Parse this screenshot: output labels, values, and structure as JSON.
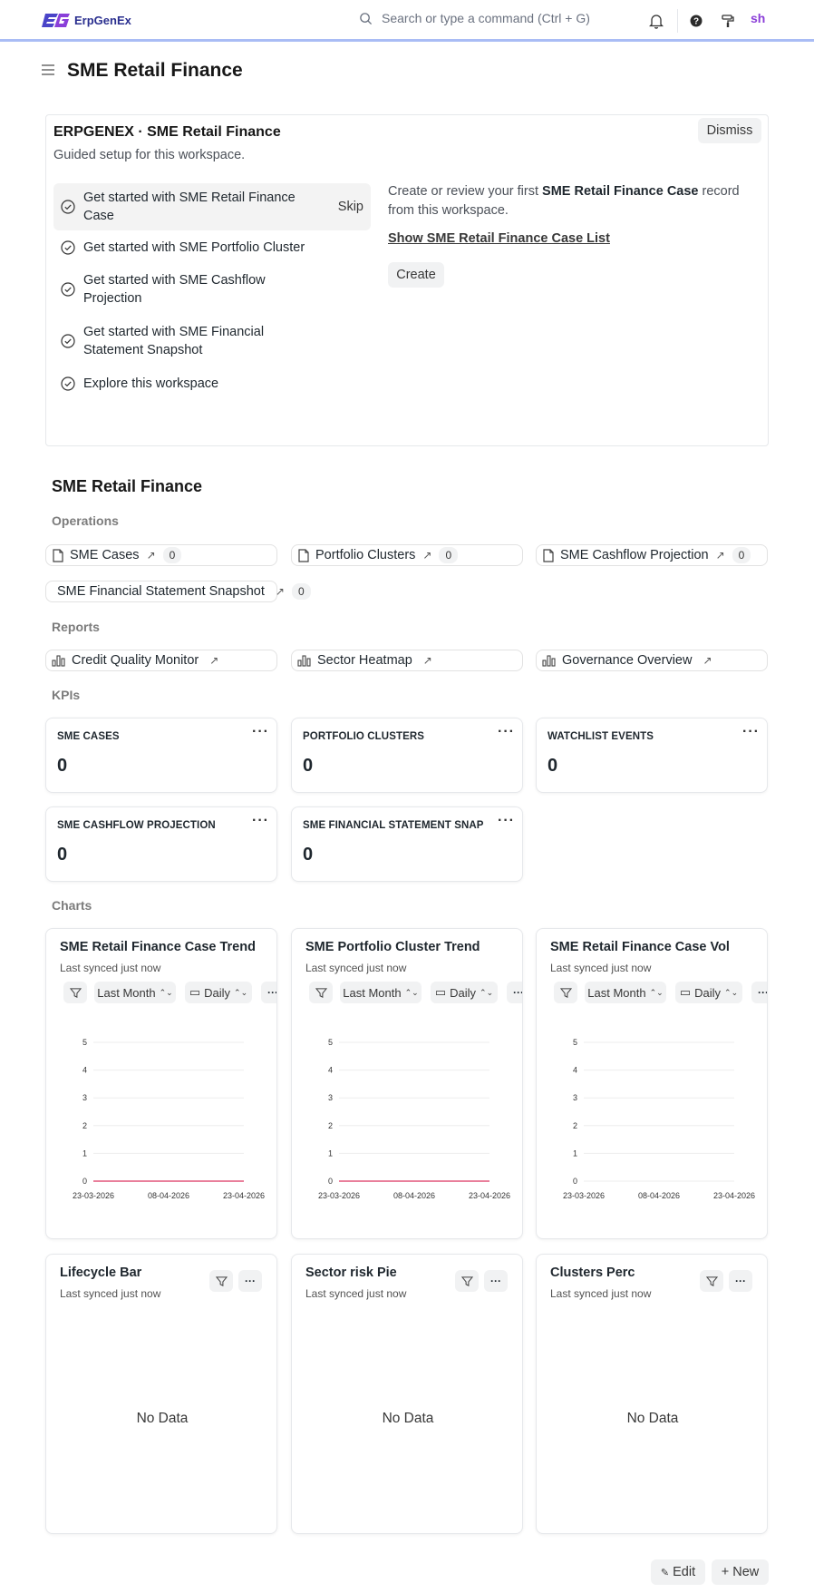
{
  "navbar": {
    "brand": "ErpGenEx",
    "search_placeholder": "Search or type a command (Ctrl + G)",
    "avatar_initials": "sh"
  },
  "page": {
    "title": "SME Retail Finance"
  },
  "onboarding": {
    "title": "ERPGENEX · SME Retail Finance",
    "subtitle": "Guided setup for this workspace.",
    "dismiss_label": "Dismiss",
    "skip_label": "Skip",
    "steps": [
      {
        "label": "Get started with SME Retail Finance Case"
      },
      {
        "label": "Get started with SME Portfolio Cluster"
      },
      {
        "label": "Get started with SME Cashflow Projection"
      },
      {
        "label": "Get started with SME Financial Statement Snapshot"
      },
      {
        "label": "Explore this workspace"
      }
    ],
    "desc_prefix": "Create or review your first ",
    "desc_bold": "SME Retail Finance Case",
    "desc_suffix": " record from this workspace.",
    "link_label": "Show SME Retail Finance Case List",
    "create_label": "Create"
  },
  "workspace": {
    "title": "SME Retail Finance",
    "sections": {
      "operations": "Operations",
      "reports": "Reports",
      "kpis": "KPIs",
      "charts": "Charts"
    },
    "operations": [
      {
        "label": "SME Cases",
        "count": "0"
      },
      {
        "label": "Portfolio Clusters",
        "count": "0"
      },
      {
        "label": "SME Cashflow Projection",
        "count": "0"
      },
      {
        "label": "SME Financial Statement Snapshot",
        "count": "0"
      }
    ],
    "reports": [
      {
        "label": "Credit Quality Monitor"
      },
      {
        "label": "Sector Heatmap"
      },
      {
        "label": "Governance Overview"
      }
    ],
    "kpis": [
      {
        "label": "SME CASES",
        "value": "0"
      },
      {
        "label": "PORTFOLIO CLUSTERS",
        "value": "0"
      },
      {
        "label": "WATCHLIST EVENTS",
        "value": "0"
      },
      {
        "label": "SME CASHFLOW PROJECTION",
        "value": "0"
      },
      {
        "label": "SME FINANCIAL STATEMENT SNAPS...",
        "value": "0"
      }
    ],
    "charts": [
      {
        "title": "SME Retail Finance Case Trend",
        "synced": "Last synced just now",
        "range": "Last Month",
        "interval": "Daily"
      },
      {
        "title": "SME Portfolio Cluster Trend",
        "synced": "Last synced just now",
        "range": "Last Month",
        "interval": "Daily"
      },
      {
        "title": "SME Retail Finance Case Vol",
        "synced": "Last synced just now",
        "range": "Last Month",
        "interval": "Daily"
      },
      {
        "title": "Lifecycle Bar",
        "synced": "Last synced just now",
        "empty": "No Data"
      },
      {
        "title": "Sector risk Pie",
        "synced": "Last synced just now",
        "empty": "No Data"
      },
      {
        "title": "Clusters Perc",
        "synced": "Last synced just now",
        "empty": "No Data"
      }
    ],
    "footer": {
      "edit_label": "Edit",
      "new_label": "New"
    }
  },
  "chart_data": [
    {
      "type": "line",
      "title": "SME Retail Finance Case Trend",
      "x": [
        "23-03-2026",
        "08-04-2026",
        "23-04-2026"
      ],
      "yticks": [
        "0",
        "1",
        "2",
        "3",
        "4",
        "5"
      ],
      "ylim": [
        0,
        5
      ],
      "series": [
        {
          "values": [
            0,
            0,
            0
          ]
        }
      ],
      "color": "#e2557a"
    },
    {
      "type": "line",
      "title": "SME Portfolio Cluster Trend",
      "x": [
        "23-03-2026",
        "08-04-2026",
        "23-04-2026"
      ],
      "yticks": [
        "0",
        "1",
        "2",
        "3",
        "4",
        "5"
      ],
      "ylim": [
        0,
        5
      ],
      "series": [
        {
          "values": [
            0,
            0,
            0
          ]
        }
      ],
      "color": "#e2557a"
    },
    {
      "type": "line",
      "title": "SME Retail Finance Case Vol",
      "x": [
        "23-03-2026",
        "08-04-2026",
        "23-04-2026"
      ],
      "yticks": [
        "0",
        "1",
        "2",
        "3",
        "4",
        "5"
      ],
      "ylim": [
        0,
        5
      ],
      "series": [],
      "color": "#e2557a"
    }
  ]
}
